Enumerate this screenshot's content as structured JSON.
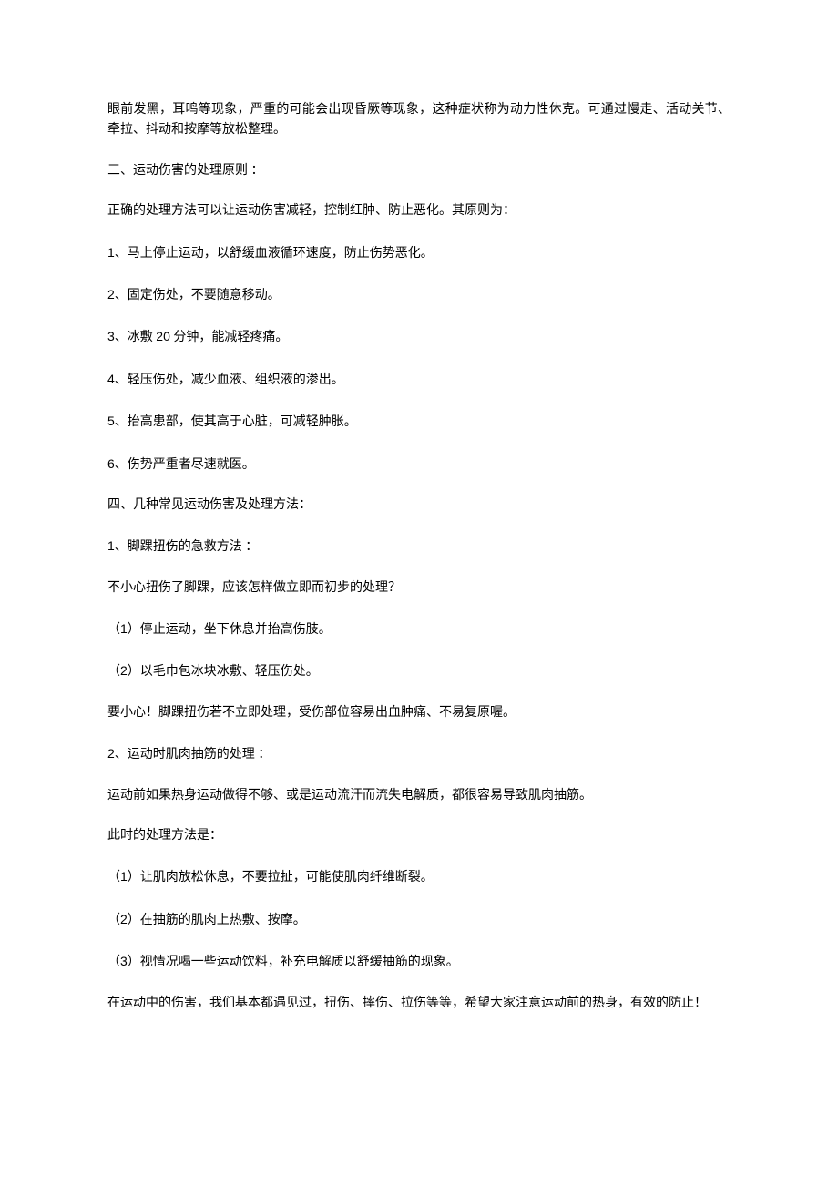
{
  "paragraphs": [
    {
      "parts": [
        {
          "t": "眼前发黑，耳鸣等现象，严重的可能会出现昏厥等现象，这种症状称为动力性休克。可通过慢走、活动关节、牵拉、抖动和按摩等放松整理。"
        }
      ]
    },
    {
      "parts": [
        {
          "t": "三、运动伤害的处理原则 ："
        }
      ]
    },
    {
      "parts": [
        {
          "t": "正确的处理方法可以让运动伤害减轻，控制红肿、防止恶化。其原则为："
        }
      ]
    },
    {
      "parts": [
        {
          "t": "1",
          "num": true
        },
        {
          "t": "、马上停止运动，以舒缓血液循环速度，防止伤势恶化。"
        }
      ]
    },
    {
      "parts": [
        {
          "t": "2",
          "num": true
        },
        {
          "t": "、固定伤处，不要随意移动。"
        }
      ]
    },
    {
      "parts": [
        {
          "t": "3",
          "num": true
        },
        {
          "t": "、冰敷 "
        },
        {
          "t": "20",
          "num": true
        },
        {
          "t": " 分钟，能减轻疼痛。"
        }
      ]
    },
    {
      "parts": [
        {
          "t": "4",
          "num": true
        },
        {
          "t": "、轻压伤处，减少血液、组织液的渗出。"
        }
      ]
    },
    {
      "parts": [
        {
          "t": "5",
          "num": true
        },
        {
          "t": "、抬高患部，使其高于心脏，可减轻肿胀。"
        }
      ]
    },
    {
      "parts": [
        {
          "t": "6",
          "num": true
        },
        {
          "t": "、伤势严重者尽速就医。"
        }
      ]
    },
    {
      "parts": [
        {
          "t": "四、几种常见运动伤害及处理方法："
        }
      ]
    },
    {
      "parts": [
        {
          "t": "1",
          "num": true
        },
        {
          "t": "、脚踝扭伤的急救方法 ："
        }
      ]
    },
    {
      "parts": [
        {
          "t": "不小心扭伤了脚踝，应该怎样做立即而初步的处理？"
        }
      ]
    },
    {
      "parts": [
        {
          "t": "（"
        },
        {
          "t": "1",
          "num": true
        },
        {
          "t": "）停止运动，坐下休息并抬高伤肢。"
        }
      ]
    },
    {
      "parts": [
        {
          "t": "（"
        },
        {
          "t": "2",
          "num": true
        },
        {
          "t": "）以毛巾包冰块冰敷、轻压伤处。"
        }
      ]
    },
    {
      "parts": [
        {
          "t": "要小心！脚踝扭伤若不立即处理，受伤部位容易出血肿痛、不易复原喔。"
        }
      ]
    },
    {
      "parts": [
        {
          "t": "2",
          "num": true
        },
        {
          "t": "、运动时肌肉抽筋的处理 ："
        }
      ]
    },
    {
      "parts": [
        {
          "t": "运动前如果热身运动做得不够、或是运动流汗而流失电解质，都很容易导致肌肉抽筋。"
        }
      ]
    },
    {
      "parts": [
        {
          "t": "此时的处理方法是："
        }
      ]
    },
    {
      "parts": [
        {
          "t": "（"
        },
        {
          "t": "1",
          "num": true
        },
        {
          "t": "）让肌肉放松休息，不要拉扯，可能使肌肉纤维断裂。"
        }
      ]
    },
    {
      "parts": [
        {
          "t": "（"
        },
        {
          "t": "2",
          "num": true
        },
        {
          "t": "）在抽筋的肌肉上热敷、按摩。"
        }
      ]
    },
    {
      "parts": [
        {
          "t": "（"
        },
        {
          "t": "3",
          "num": true
        },
        {
          "t": "）视情况喝一些运动饮料，补充电解质以舒缓抽筋的现象。"
        }
      ]
    },
    {
      "parts": [
        {
          "t": "在运动中的伤害，我们基本都遇见过，扭伤、摔伤、拉伤等等，希望大家注意运动前的热身，有效的防止！"
        }
      ]
    }
  ]
}
